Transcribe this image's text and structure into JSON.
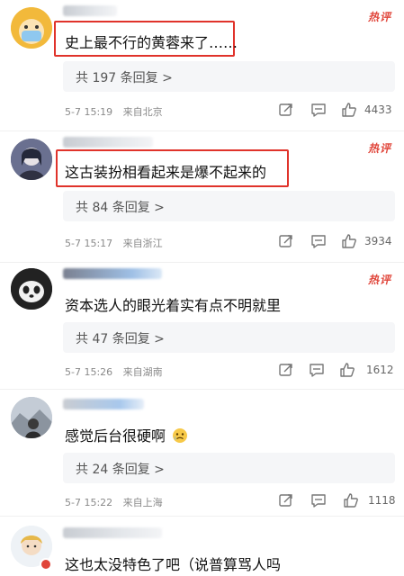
{
  "hot_label": "热评",
  "comments": [
    {
      "text": "史上最不行的黄蓉来了……",
      "replies": "共 197 条回复 >",
      "date": "5-7 15:19",
      "location": "来自北京",
      "likes": "4433"
    },
    {
      "text": "这古装扮相看起来是爆不起来的",
      "replies": "共 84 条回复 >",
      "date": "5-7 15:17",
      "location": "来自浙江",
      "likes": "3934"
    },
    {
      "text": "资本选人的眼光着实有点不明就里",
      "replies": "共 47 条回复 >",
      "date": "5-7 15:26",
      "location": "来自湖南",
      "likes": "1612"
    },
    {
      "text": "感觉后台很硬啊",
      "replies": "共 24 条回复 >",
      "date": "5-7 15:22",
      "location": "来自上海",
      "likes": "1118"
    },
    {
      "text": "这也太没特色了吧（说普算骂人吗"
    }
  ]
}
